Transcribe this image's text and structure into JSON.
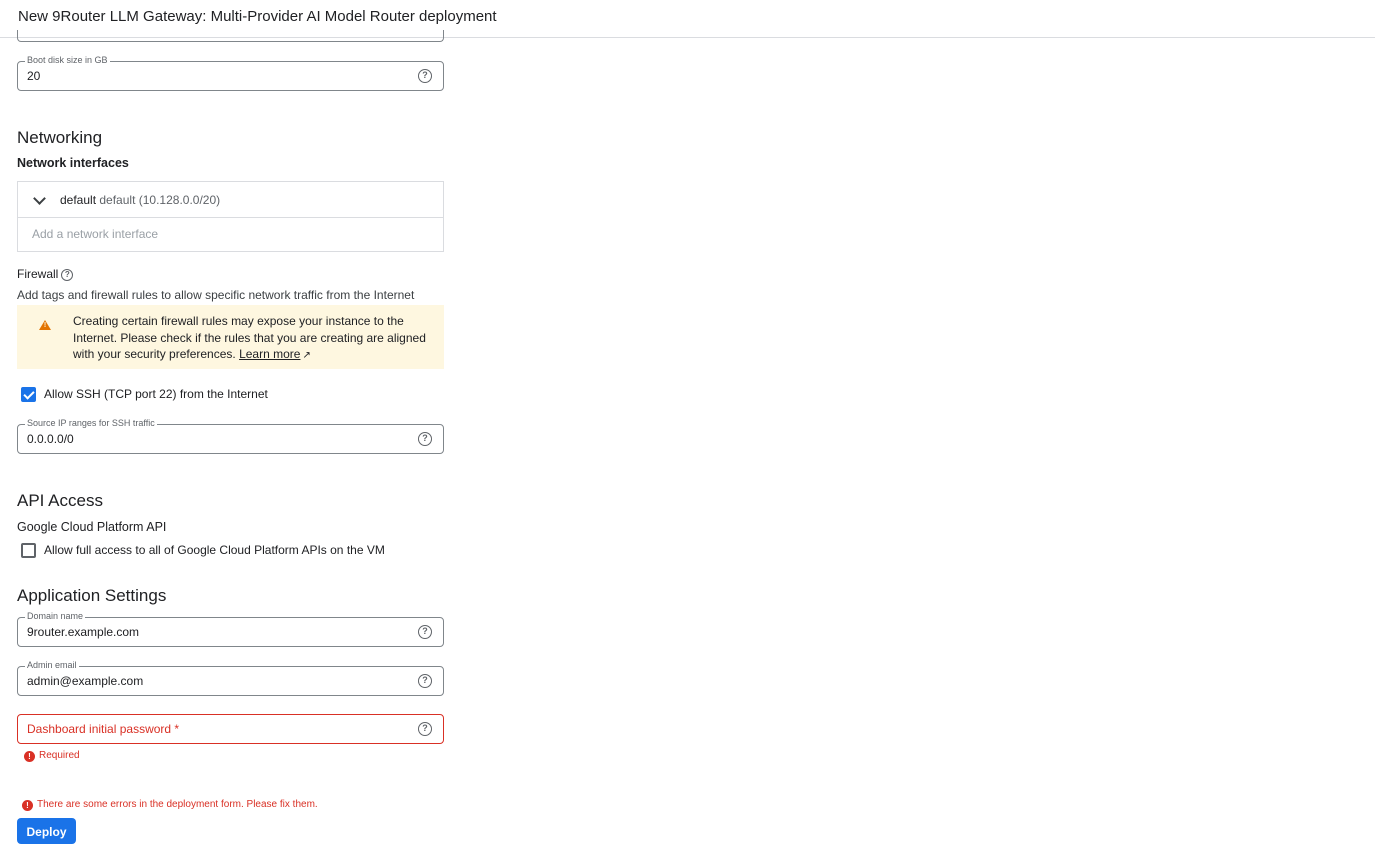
{
  "header": {
    "title": "New 9Router LLM Gateway: Multi-Provider AI Model Router deployment"
  },
  "boot_disk": {
    "label": "Boot disk size in GB",
    "value": "20"
  },
  "networking": {
    "title": "Networking",
    "interfaces_title": "Network interfaces",
    "interface": {
      "name": "default",
      "detail": "default (10.128.0.0/20)"
    },
    "add_interface": "Add a network interface",
    "firewall_label": "Firewall",
    "firewall_desc": "Add tags and firewall rules to allow specific network traffic from the Internet",
    "warning": {
      "text": "Creating certain firewall rules may expose your instance to the Internet. Please check if the rules that you are creating are aligned with your security preferences.",
      "link": "Learn more"
    },
    "ssh_checkbox": {
      "label": "Allow SSH (TCP port 22) from the Internet",
      "checked": true
    },
    "ssh_source": {
      "label": "Source IP ranges for SSH traffic",
      "value": "0.0.0.0/0"
    }
  },
  "api_access": {
    "title": "API Access",
    "subtitle": "Google Cloud Platform API",
    "checkbox": {
      "label": "Allow full access to all of Google Cloud Platform APIs on the VM",
      "checked": false
    }
  },
  "app_settings": {
    "title": "Application Settings",
    "domain": {
      "label": "Domain name",
      "value": "9router.example.com"
    },
    "admin_email": {
      "label": "Admin email",
      "value": "admin@example.com"
    },
    "password": {
      "placeholder": "Dashboard initial password *",
      "error": "Required"
    }
  },
  "form_error": "There are some errors in the deployment form. Please fix them.",
  "deploy_label": "Deploy",
  "colors": {
    "accent": "#1a73e8",
    "error": "#d93025",
    "warning_bg": "#fef7e0"
  }
}
